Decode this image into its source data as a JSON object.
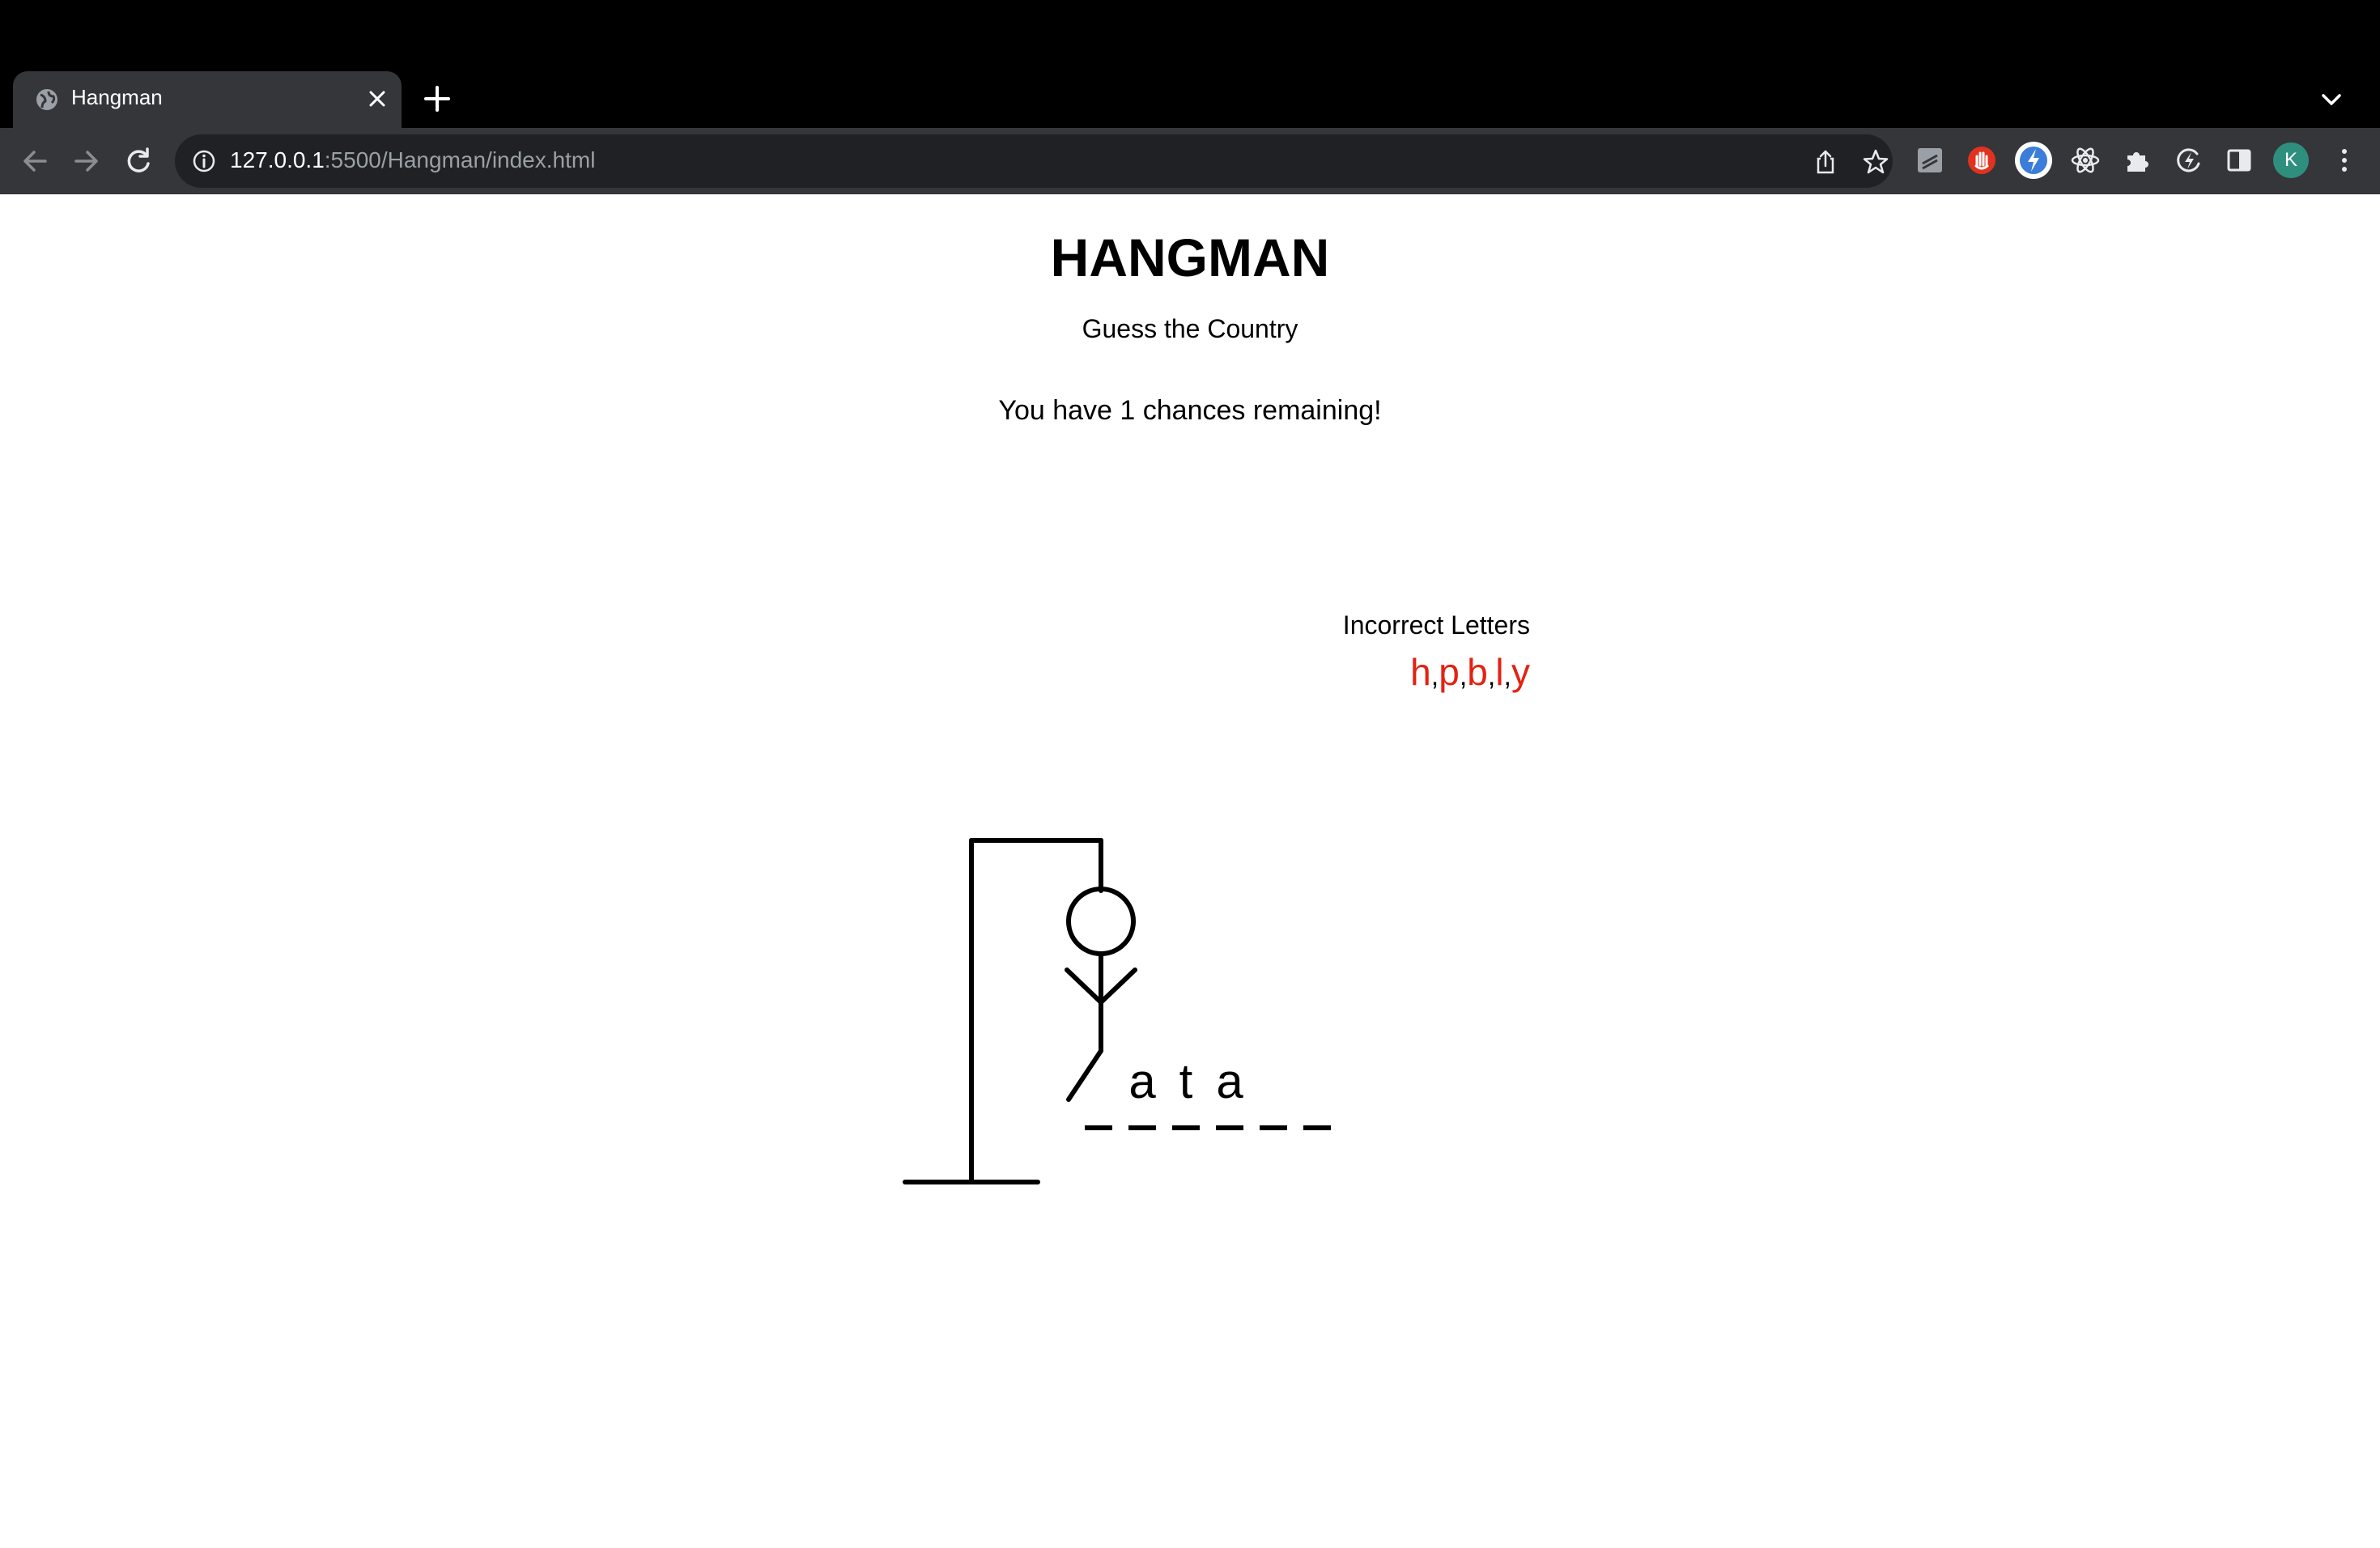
{
  "browser": {
    "tab_title": "Hangman",
    "url_host": "127.0.0.1",
    "url_rest": ":5500/Hangman/index.html",
    "profile_initial": "K"
  },
  "game": {
    "title": "HANGMAN",
    "subtitle": "Guess the Country",
    "chances_message": "You have 1 chances remaining!",
    "incorrect_label": "Incorrect Letters",
    "incorrect_letters": [
      "h",
      "p",
      "b",
      "l",
      "y"
    ],
    "incorrect_separator": ",",
    "word_slots": [
      "",
      "a",
      "t",
      "a",
      "",
      ""
    ],
    "figure_parts_shown": [
      "head",
      "body",
      "left-arm",
      "right-arm",
      "left-leg"
    ]
  },
  "colors": {
    "wrong_letter": "#e32212",
    "chrome_bg": "#000000",
    "toolbar_bg": "#35363a",
    "omnibox_bg": "#202124",
    "avatar": "#2f8f7f"
  }
}
